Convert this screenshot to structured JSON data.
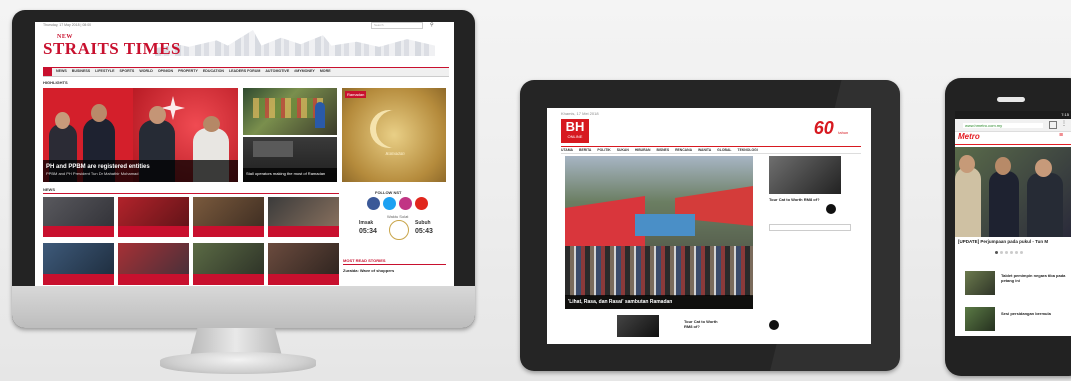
{
  "desktop": {
    "date_line": "Thursday, 17 May 2018 | 08:00",
    "search_placeholder": "Search",
    "logo_new": "NEW",
    "logo_main": "STRAITS TIMES",
    "nav": [
      "NEWS",
      "BUSINESS",
      "LIFESTYLE",
      "SPORTS",
      "WORLD",
      "OPINION",
      "PROPERTY",
      "EDUCATION",
      "LEADERS FORUM",
      "AUTOMOTIVE",
      "#MYMONEY",
      "MORE"
    ],
    "highlights_label": "HIGHLIGHTS",
    "headline": "PH and PPBM are registered entities",
    "headline_sub": "PPBM and PH President Tun Dr Mahathir Mohamad",
    "side_story": "Stall operators making the most of Ramadan",
    "ad_label": "Ramadan",
    "follow_label": "FOLLOW NST",
    "news_label": "NEWS",
    "prayer_label": "Waktu Solat",
    "prayer_left_name": "Imsak",
    "prayer_left_time": "05:34",
    "prayer_right_name": "Subuh",
    "prayer_right_time": "05:43",
    "most_read_label": "MOST READ STORIES",
    "most_read_item": "Zuraida: Wave of shoppers"
  },
  "tablet": {
    "logo": "BH",
    "logo_sub": "ONLINE",
    "anniv": "60",
    "anniv_sub": "tahun",
    "top_links": "Khamis, 17 Mei 2018",
    "nav": [
      "UTAMA",
      "BERITA",
      "POLITIK",
      "SUKAN",
      "HIBURAN",
      "BISNES",
      "RENCANA",
      "WANITA",
      "GLOBAL",
      "TEKNOLOGI"
    ],
    "headline": "'Lihat, Rasa, dan Rasai' sambutan Ramadan",
    "side_title": "Tour Cat to Worth RM8 of?",
    "bottom_title": "Tour Cat to Worth RM8 of?"
  },
  "phone": {
    "status_time": "7:15",
    "url": "www.hmetro.com.my",
    "logo": "Metro",
    "headline": "[UPDATE] Perjumpaan pada pukul - Tun M",
    "list_item_1": "Tablet pemimpin negara tiba pada petang ini",
    "list_item_2": "Sesi persidangan bermula"
  },
  "colors": {
    "nst_red": "#c8102e",
    "bh_red": "#d71920",
    "metro_red": "#e31e24",
    "device_frame": "#232323"
  }
}
